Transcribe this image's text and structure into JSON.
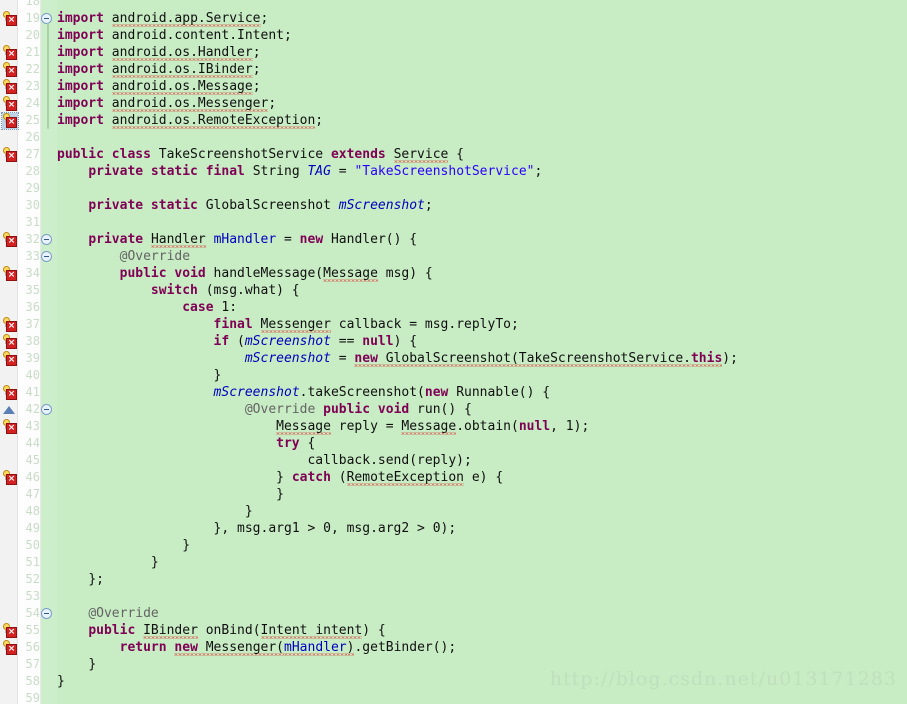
{
  "editor": {
    "language": "java",
    "theme_background": "#c8ecc4",
    "gutter_background": "#fdfdfd",
    "line_number_color": "#c9dcc7",
    "keyword_color": "#7f0055",
    "string_color": "#2a00ff",
    "field_color": "#0000c0",
    "annotation_color": "#646464",
    "error_underline_color": "#e01b1b",
    "first_visible_line": 18,
    "last_visible_line": 59,
    "line_height_px": 17
  },
  "watermark": {
    "text": "http://blog.csdn.net/u013171283"
  },
  "gutter": {
    "quickfix_icon_name": "lightbulb-error-icon",
    "override_icon_name": "implements-triangle-icon",
    "fold_toggle_icon_name": "fold-collapse-icon",
    "quickfix_lines": [
      19,
      21,
      22,
      23,
      24,
      25,
      27,
      32,
      34,
      37,
      38,
      39,
      41,
      43,
      46,
      55,
      56
    ],
    "selected_quickfix_line": 25,
    "override_marker_lines": [
      42
    ],
    "fold_toggle_lines": [
      19,
      32,
      33,
      42,
      54
    ]
  },
  "code": {
    "lines": [
      {
        "n": 18,
        "indent": 0,
        "tokens": []
      },
      {
        "n": 19,
        "indent": 0,
        "tokens": [
          {
            "t": "import ",
            "c": "kw"
          },
          {
            "t": "android.app.Service",
            "c": "plain",
            "sq": true
          },
          {
            "t": ";",
            "c": "plain"
          }
        ]
      },
      {
        "n": 20,
        "indent": 0,
        "tokens": [
          {
            "t": "import ",
            "c": "kw"
          },
          {
            "t": "android.content.Intent;",
            "c": "plain"
          }
        ]
      },
      {
        "n": 21,
        "indent": 0,
        "tokens": [
          {
            "t": "import ",
            "c": "kw"
          },
          {
            "t": "android.os.Handler",
            "c": "plain",
            "sq": true
          },
          {
            "t": ";",
            "c": "plain"
          }
        ]
      },
      {
        "n": 22,
        "indent": 0,
        "tokens": [
          {
            "t": "import ",
            "c": "kw"
          },
          {
            "t": "android.os.IBinder",
            "c": "plain",
            "sq": true
          },
          {
            "t": ";",
            "c": "plain"
          }
        ]
      },
      {
        "n": 23,
        "indent": 0,
        "tokens": [
          {
            "t": "import ",
            "c": "kw"
          },
          {
            "t": "android.os.Message",
            "c": "plain",
            "sq": true
          },
          {
            "t": ";",
            "c": "plain"
          }
        ]
      },
      {
        "n": 24,
        "indent": 0,
        "tokens": [
          {
            "t": "import ",
            "c": "kw"
          },
          {
            "t": "android.os.Messenger",
            "c": "plain",
            "sq": true
          },
          {
            "t": ";",
            "c": "plain"
          }
        ]
      },
      {
        "n": 25,
        "indent": 0,
        "tokens": [
          {
            "t": "import ",
            "c": "kw"
          },
          {
            "t": "android.os.RemoteException",
            "c": "plain",
            "sq": true
          },
          {
            "t": ";",
            "c": "plain"
          }
        ]
      },
      {
        "n": 26,
        "indent": 0,
        "tokens": []
      },
      {
        "n": 27,
        "indent": 0,
        "tokens": [
          {
            "t": "public class ",
            "c": "kw"
          },
          {
            "t": "TakeScreenshotService ",
            "c": "plain"
          },
          {
            "t": "extends ",
            "c": "kw"
          },
          {
            "t": "Service",
            "c": "plain",
            "sq": true
          },
          {
            "t": " {",
            "c": "plain"
          }
        ]
      },
      {
        "n": 28,
        "indent": 1,
        "tokens": [
          {
            "t": "private static final ",
            "c": "kw"
          },
          {
            "t": "String ",
            "c": "plain"
          },
          {
            "t": "TAG",
            "c": "fld"
          },
          {
            "t": " = ",
            "c": "plain"
          },
          {
            "t": "\"TakeScreenshotService\"",
            "c": "str"
          },
          {
            "t": ";",
            "c": "plain"
          }
        ]
      },
      {
        "n": 29,
        "indent": 0,
        "tokens": []
      },
      {
        "n": 30,
        "indent": 1,
        "tokens": [
          {
            "t": "private static ",
            "c": "kw"
          },
          {
            "t": "GlobalScreenshot ",
            "c": "plain"
          },
          {
            "t": "mScreenshot",
            "c": "fld"
          },
          {
            "t": ";",
            "c": "plain"
          }
        ]
      },
      {
        "n": 31,
        "indent": 0,
        "tokens": []
      },
      {
        "n": 32,
        "indent": 1,
        "tokens": [
          {
            "t": "private ",
            "c": "kw"
          },
          {
            "t": "Handler",
            "c": "plain",
            "sq": true
          },
          {
            "t": " ",
            "c": "plain"
          },
          {
            "t": "mHandler",
            "c": "fldb"
          },
          {
            "t": " = ",
            "c": "plain"
          },
          {
            "t": "new ",
            "c": "kw"
          },
          {
            "t": "Handler() {",
            "c": "plain"
          }
        ]
      },
      {
        "n": 33,
        "indent": 2,
        "tokens": [
          {
            "t": "@Override",
            "c": "ann"
          }
        ]
      },
      {
        "n": 34,
        "indent": 2,
        "tokens": [
          {
            "t": "public void ",
            "c": "kw"
          },
          {
            "t": "handleMessage(",
            "c": "plain"
          },
          {
            "t": "Message",
            "c": "plain",
            "sq": true
          },
          {
            "t": " msg) {",
            "c": "plain"
          }
        ]
      },
      {
        "n": 35,
        "indent": 3,
        "tokens": [
          {
            "t": "switch ",
            "c": "kw"
          },
          {
            "t": "(msg.what) {",
            "c": "plain"
          }
        ]
      },
      {
        "n": 36,
        "indent": 4,
        "tokens": [
          {
            "t": "case ",
            "c": "kw"
          },
          {
            "t": "1:",
            "c": "plain"
          }
        ]
      },
      {
        "n": 37,
        "indent": 5,
        "tokens": [
          {
            "t": "final ",
            "c": "kw"
          },
          {
            "t": "Messenger",
            "c": "plain",
            "sq": true
          },
          {
            "t": " callback = msg.replyTo;",
            "c": "plain"
          }
        ]
      },
      {
        "n": 38,
        "indent": 5,
        "tokens": [
          {
            "t": "if ",
            "c": "kw"
          },
          {
            "t": "(",
            "c": "plain"
          },
          {
            "t": "mScreenshot",
            "c": "fld"
          },
          {
            "t": " == ",
            "c": "plain"
          },
          {
            "t": "null",
            "c": "kw"
          },
          {
            "t": ") {",
            "c": "plain"
          }
        ]
      },
      {
        "n": 39,
        "indent": 6,
        "tokens": [
          {
            "t": "mScreenshot",
            "c": "fld"
          },
          {
            "t": " = ",
            "c": "plain"
          },
          {
            "t": "new ",
            "c": "kw",
            "sq": true
          },
          {
            "t": "GlobalScreenshot(TakeScreenshotService.",
            "c": "plain",
            "sq": true
          },
          {
            "t": "this",
            "c": "kw",
            "sq": true
          },
          {
            "t": ");",
            "c": "plain"
          }
        ]
      },
      {
        "n": 40,
        "indent": 5,
        "tokens": [
          {
            "t": "}",
            "c": "plain"
          }
        ]
      },
      {
        "n": 41,
        "indent": 5,
        "tokens": [
          {
            "t": "mScreenshot",
            "c": "fld"
          },
          {
            "t": ".takeScreenshot(",
            "c": "plain"
          },
          {
            "t": "new ",
            "c": "kw"
          },
          {
            "t": "Runnable() {",
            "c": "plain"
          }
        ]
      },
      {
        "n": 42,
        "indent": 6,
        "tokens": [
          {
            "t": "@Override",
            "c": "ann"
          },
          {
            "t": " ",
            "c": "plain"
          },
          {
            "t": "public void ",
            "c": "kw"
          },
          {
            "t": "run() {",
            "c": "plain"
          }
        ]
      },
      {
        "n": 43,
        "indent": 7,
        "tokens": [
          {
            "t": "Message",
            "c": "plain",
            "sq": true
          },
          {
            "t": " reply = ",
            "c": "plain"
          },
          {
            "t": "Message",
            "c": "plain",
            "sq": true
          },
          {
            "t": ".obtain(",
            "c": "plain"
          },
          {
            "t": "null",
            "c": "kw"
          },
          {
            "t": ", 1);",
            "c": "plain"
          }
        ]
      },
      {
        "n": 44,
        "indent": 7,
        "tokens": [
          {
            "t": "try ",
            "c": "kw"
          },
          {
            "t": "{",
            "c": "plain"
          }
        ]
      },
      {
        "n": 45,
        "indent": 8,
        "tokens": [
          {
            "t": "callback.send(reply);",
            "c": "plain"
          }
        ]
      },
      {
        "n": 46,
        "indent": 7,
        "tokens": [
          {
            "t": "} ",
            "c": "plain"
          },
          {
            "t": "catch ",
            "c": "kw"
          },
          {
            "t": "(",
            "c": "plain"
          },
          {
            "t": "RemoteException",
            "c": "plain",
            "sq": true
          },
          {
            "t": " e) {",
            "c": "plain"
          }
        ]
      },
      {
        "n": 47,
        "indent": 7,
        "tokens": [
          {
            "t": "}",
            "c": "plain"
          }
        ]
      },
      {
        "n": 48,
        "indent": 6,
        "tokens": [
          {
            "t": "}",
            "c": "plain"
          }
        ]
      },
      {
        "n": 49,
        "indent": 5,
        "tokens": [
          {
            "t": "}, msg.arg1 > 0, msg.arg2 > 0);",
            "c": "plain"
          }
        ]
      },
      {
        "n": 50,
        "indent": 4,
        "tokens": [
          {
            "t": "}",
            "c": "plain"
          }
        ]
      },
      {
        "n": 51,
        "indent": 3,
        "tokens": [
          {
            "t": "}",
            "c": "plain"
          }
        ]
      },
      {
        "n": 52,
        "indent": 1,
        "tokens": [
          {
            "t": "};",
            "c": "plain"
          }
        ]
      },
      {
        "n": 53,
        "indent": 0,
        "tokens": []
      },
      {
        "n": 54,
        "indent": 1,
        "tokens": [
          {
            "t": "@Override",
            "c": "ann"
          }
        ]
      },
      {
        "n": 55,
        "indent": 1,
        "tokens": [
          {
            "t": "public ",
            "c": "kw"
          },
          {
            "t": "IBinder",
            "c": "plain",
            "sq": true
          },
          {
            "t": " onBind(",
            "c": "plain"
          },
          {
            "t": "Intent intent",
            "c": "plain",
            "sq": true
          },
          {
            "t": ") {",
            "c": "plain"
          }
        ]
      },
      {
        "n": 56,
        "indent": 2,
        "tokens": [
          {
            "t": "return ",
            "c": "kw"
          },
          {
            "t": "new ",
            "c": "kw",
            "sq": true
          },
          {
            "t": "Messenger(",
            "c": "plain",
            "sq": true
          },
          {
            "t": "mHandler",
            "c": "fldb",
            "sq": true
          },
          {
            "t": ")",
            "c": "plain",
            "sq": true
          },
          {
            "t": ".getBinder();",
            "c": "plain"
          }
        ]
      },
      {
        "n": 57,
        "indent": 1,
        "tokens": [
          {
            "t": "}",
            "c": "plain"
          }
        ]
      },
      {
        "n": 58,
        "indent": 0,
        "tokens": [
          {
            "t": "}",
            "c": "plain"
          }
        ]
      },
      {
        "n": 59,
        "indent": 0,
        "tokens": []
      }
    ]
  }
}
